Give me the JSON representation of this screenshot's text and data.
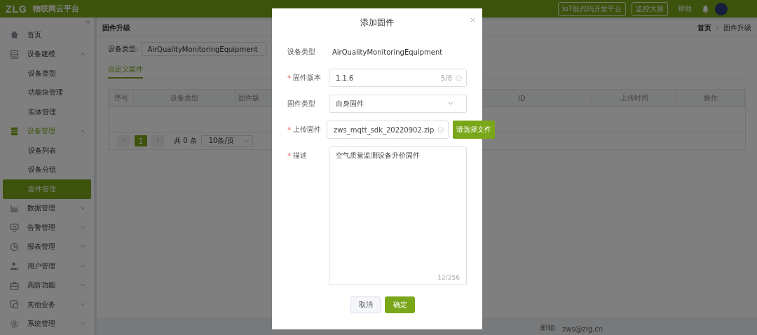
{
  "header": {
    "logo": "ZLG",
    "title": "物联网云平台",
    "buttons": [
      "IoT低代码开发平台",
      "监控大屏"
    ],
    "help": "帮助"
  },
  "sidebar": {
    "items": [
      {
        "label": "首页",
        "kind": "link",
        "active": false
      },
      {
        "label": "设备建模",
        "kind": "group",
        "expanded": true,
        "active": false,
        "children": [
          {
            "label": "设备类型",
            "selected": false
          },
          {
            "label": "功能块管理",
            "selected": false
          },
          {
            "label": "实体管理",
            "selected": false
          }
        ]
      },
      {
        "label": "设备管理",
        "kind": "group",
        "expanded": true,
        "active": true,
        "children": [
          {
            "label": "设备列表",
            "selected": false
          },
          {
            "label": "设备分组",
            "selected": false
          },
          {
            "label": "固件管理",
            "selected": true
          }
        ]
      },
      {
        "label": "数据管理",
        "kind": "group",
        "expanded": false,
        "active": false
      },
      {
        "label": "告警管理",
        "kind": "group",
        "expanded": false,
        "active": false
      },
      {
        "label": "报表管理",
        "kind": "group",
        "expanded": false,
        "active": false
      },
      {
        "label": "用户管理",
        "kind": "group",
        "expanded": false,
        "active": false
      },
      {
        "label": "高阶功能",
        "kind": "group",
        "expanded": false,
        "active": false
      },
      {
        "label": "其他业务",
        "kind": "group",
        "expanded": false,
        "active": false
      },
      {
        "label": "系统管理",
        "kind": "group",
        "expanded": false,
        "active": false
      }
    ]
  },
  "content": {
    "title": "固件升级",
    "breadcrumb": [
      "首页",
      "固件升级"
    ],
    "filter": {
      "label": "设备类型:",
      "value": "AirQualityMonitoringEquipment"
    },
    "tabs": [
      {
        "label": "自定义固件",
        "selected": true
      }
    ],
    "table": {
      "columns": [
        "序号",
        "设备类型",
        "固件版",
        "ID",
        "上传时间",
        "操作"
      ]
    },
    "pagination": {
      "pages": [
        {
          "label": "1",
          "selected": true
        }
      ],
      "total": "共 0 条",
      "page_size": "10条/页"
    }
  },
  "footer": {
    "email_label": "邮箱:",
    "email": "zws@zlg.cn"
  },
  "dialog": {
    "title": "添加固件",
    "required_mark": "*",
    "fields": [
      {
        "kind": "text",
        "label": "设备类型",
        "required": false,
        "value": "AirQualityMonitoringEquipment"
      },
      {
        "kind": "input",
        "label": "固件版本",
        "required": true,
        "value": "1.1.6",
        "counter": "5/8"
      },
      {
        "kind": "select",
        "label": "固件类型",
        "required": false,
        "value": "自身固件"
      },
      {
        "kind": "file",
        "label": "上传固件",
        "required": true,
        "value": "zws_mqtt_sdk_20220902.zip",
        "button": "请选择文件"
      },
      {
        "kind": "textarea",
        "label": "描述",
        "required": true,
        "value": "空气质量监测设备升价固件",
        "counter": "12/256"
      }
    ],
    "buttons": [
      {
        "label": "取消",
        "kind": "secondary"
      },
      {
        "label": "确定",
        "kind": "primary"
      }
    ]
  }
}
